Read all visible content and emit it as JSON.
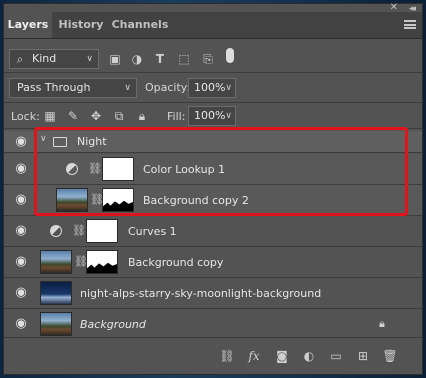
{
  "tabs": [
    {
      "label": "Layers",
      "active": true
    },
    {
      "label": "History",
      "active": false
    },
    {
      "label": "Channels",
      "active": false
    }
  ],
  "filter": {
    "kind_label": "Kind"
  },
  "blend": {
    "mode": "Pass Through",
    "opacity_label": "Opacity:",
    "opacity_value": "100%"
  },
  "lock": {
    "label": "Lock:",
    "fill_label": "Fill:",
    "fill_value": "100%"
  },
  "layers": [
    {
      "name": "Night",
      "type": "group"
    },
    {
      "name": "Color Lookup 1",
      "type": "adjustment",
      "in_group": true
    },
    {
      "name": "Background copy 2",
      "type": "pixel-mask",
      "in_group": true
    },
    {
      "name": "Curves 1",
      "type": "adjustment"
    },
    {
      "name": "Background copy",
      "type": "pixel-mask"
    },
    {
      "name": "night-alps-starry-sky-moonlight-background",
      "type": "pixel"
    },
    {
      "name": "Background",
      "type": "background",
      "locked": true
    }
  ],
  "colors": {
    "highlight_box": "#e0141b",
    "panel": "#535353",
    "tab_bar": "#424242"
  },
  "icons": {
    "filter": [
      "search-icon",
      "image-filter-icon",
      "adjustment-filter-icon",
      "type-filter-icon",
      "shape-filter-icon",
      "smart-object-filter-icon",
      "filter-toggle-icon"
    ],
    "lock": [
      "lock-transparent-icon",
      "lock-paint-icon",
      "lock-position-icon",
      "lock-artboard-icon",
      "lock-all-icon"
    ],
    "bottom": [
      "link-icon",
      "fx-icon",
      "mask-icon",
      "adjustment-layer-icon",
      "group-icon",
      "new-layer-icon",
      "trash-icon"
    ]
  }
}
